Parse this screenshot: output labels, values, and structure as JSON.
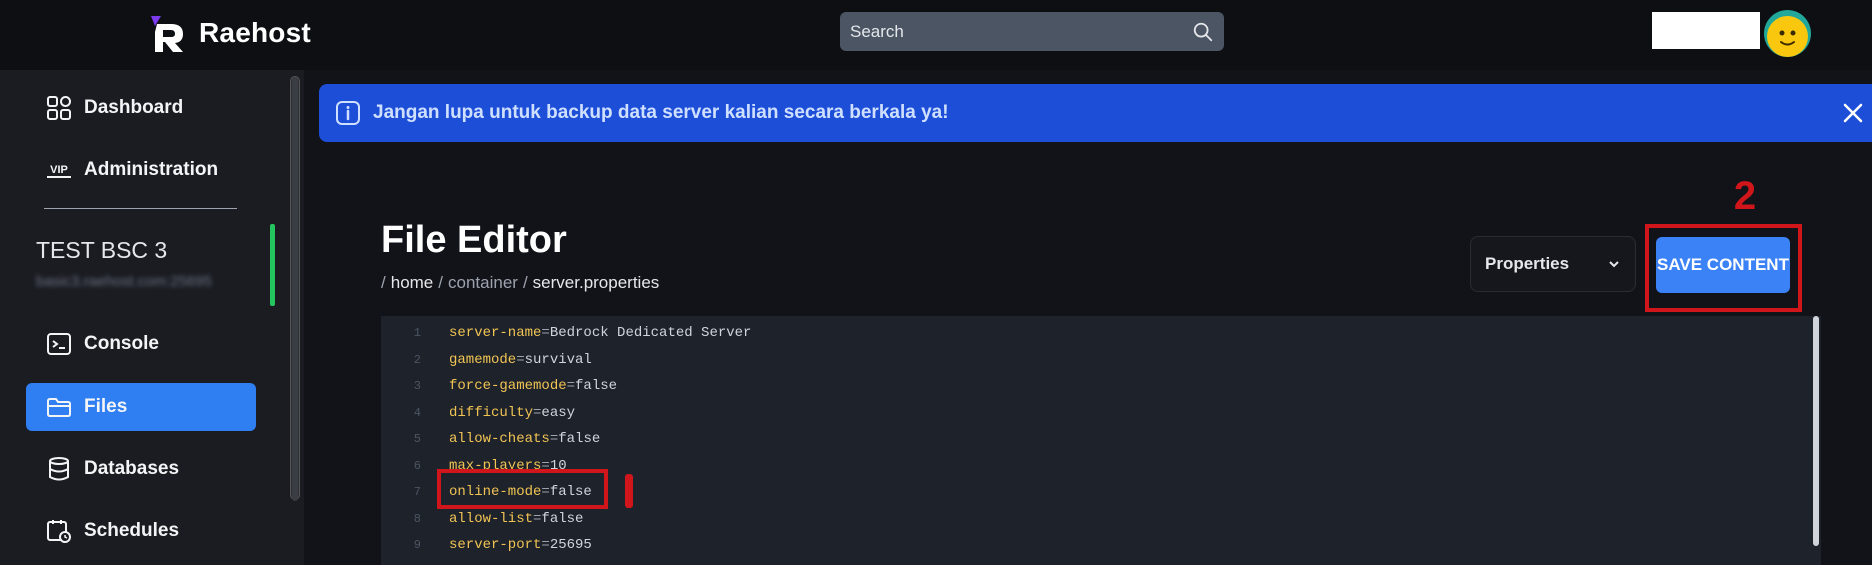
{
  "brand": {
    "name": "Raehost"
  },
  "search": {
    "placeholder": "Search"
  },
  "sidebar": {
    "items": [
      {
        "label": "Dashboard",
        "icon": "grid-icon"
      },
      {
        "label": "Administration",
        "icon": "vip-icon"
      },
      {
        "label": "Console",
        "icon": "terminal-icon"
      },
      {
        "label": "Files",
        "icon": "folder-icon",
        "active": true
      },
      {
        "label": "Databases",
        "icon": "database-icon"
      },
      {
        "label": "Schedules",
        "icon": "calendar-clock-icon"
      }
    ],
    "vip_text": "VIP",
    "server_name": "TEST BSC 3",
    "server_address": "basic3.raehost.com:25695"
  },
  "banner": {
    "message": "Jangan lupa untuk backup data server kalian secara berkala ya!"
  },
  "editor_page": {
    "title": "File Editor",
    "breadcrumb": [
      "/",
      "home",
      "/",
      "container",
      "/",
      "server.properties"
    ],
    "mode_select": "Properties",
    "save_label": "SAVE CONTENT",
    "annotation_1": "1",
    "annotation_2": "2"
  },
  "file_lines": [
    {
      "no": "1",
      "key": "server-name",
      "value": "Bedrock Dedicated Server"
    },
    {
      "no": "2",
      "key": "gamemode",
      "value": "survival"
    },
    {
      "no": "3",
      "key": "force-gamemode",
      "value": "false"
    },
    {
      "no": "4",
      "key": "difficulty",
      "value": "easy"
    },
    {
      "no": "5",
      "key": "allow-cheats",
      "value": "false"
    },
    {
      "no": "6",
      "key": "max-players",
      "value": "10"
    },
    {
      "no": "7",
      "key": "online-mode",
      "value": "false"
    },
    {
      "no": "8",
      "key": "allow-list",
      "value": "false"
    },
    {
      "no": "9",
      "key": "server-port",
      "value": "25695"
    }
  ],
  "colors": {
    "accent": "#3b82f6",
    "banner": "#1d4ed8",
    "annotation": "#d0161b",
    "key": "#f1c454"
  }
}
